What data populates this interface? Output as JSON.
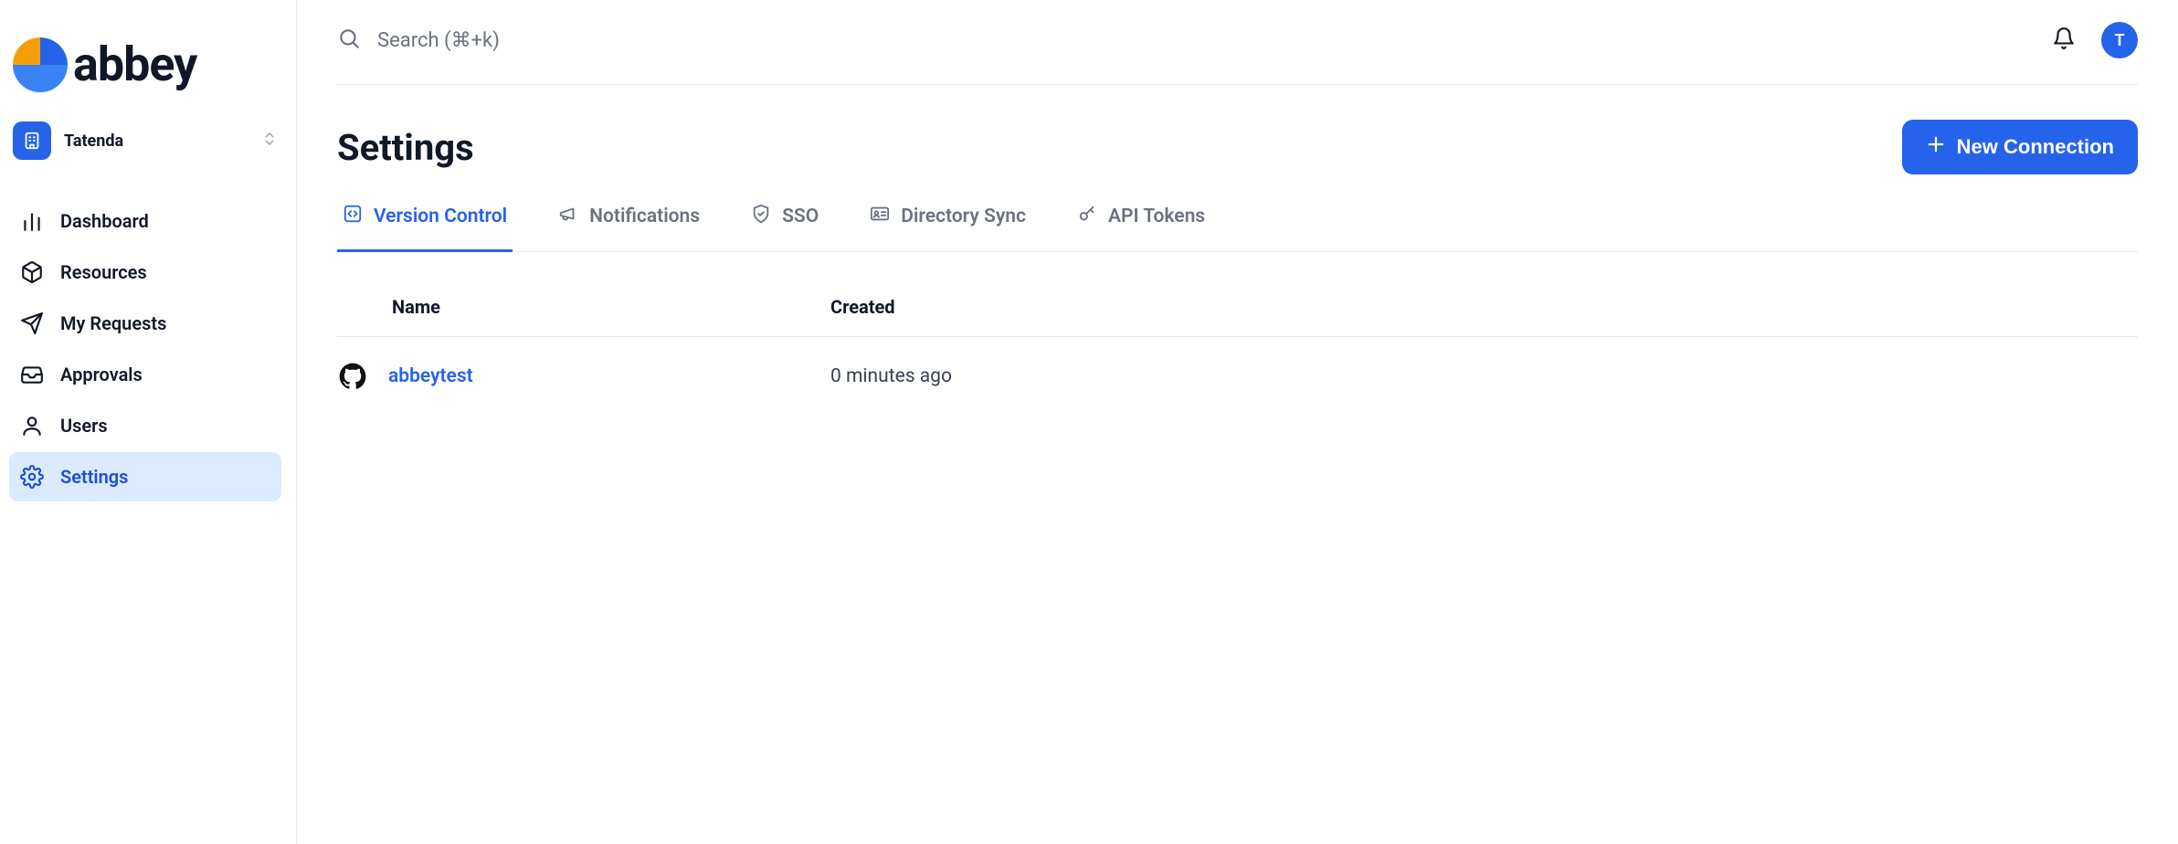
{
  "brand": {
    "name": "abbey"
  },
  "org": {
    "name": "Tatenda"
  },
  "nav": {
    "dashboard": "Dashboard",
    "resources": "Resources",
    "my_requests": "My Requests",
    "approvals": "Approvals",
    "users": "Users",
    "settings": "Settings"
  },
  "search": {
    "placeholder": "Search (⌘+k)"
  },
  "user": {
    "initial": "T"
  },
  "page": {
    "title": "Settings",
    "new_connection_label": "New Connection"
  },
  "tabs": {
    "version_control": "Version Control",
    "notifications": "Notifications",
    "sso": "SSO",
    "directory_sync": "Directory Sync",
    "api_tokens": "API Tokens"
  },
  "table": {
    "headers": {
      "name": "Name",
      "created": "Created"
    },
    "rows": [
      {
        "name": "abbeytest",
        "created": "0 minutes ago"
      }
    ]
  }
}
